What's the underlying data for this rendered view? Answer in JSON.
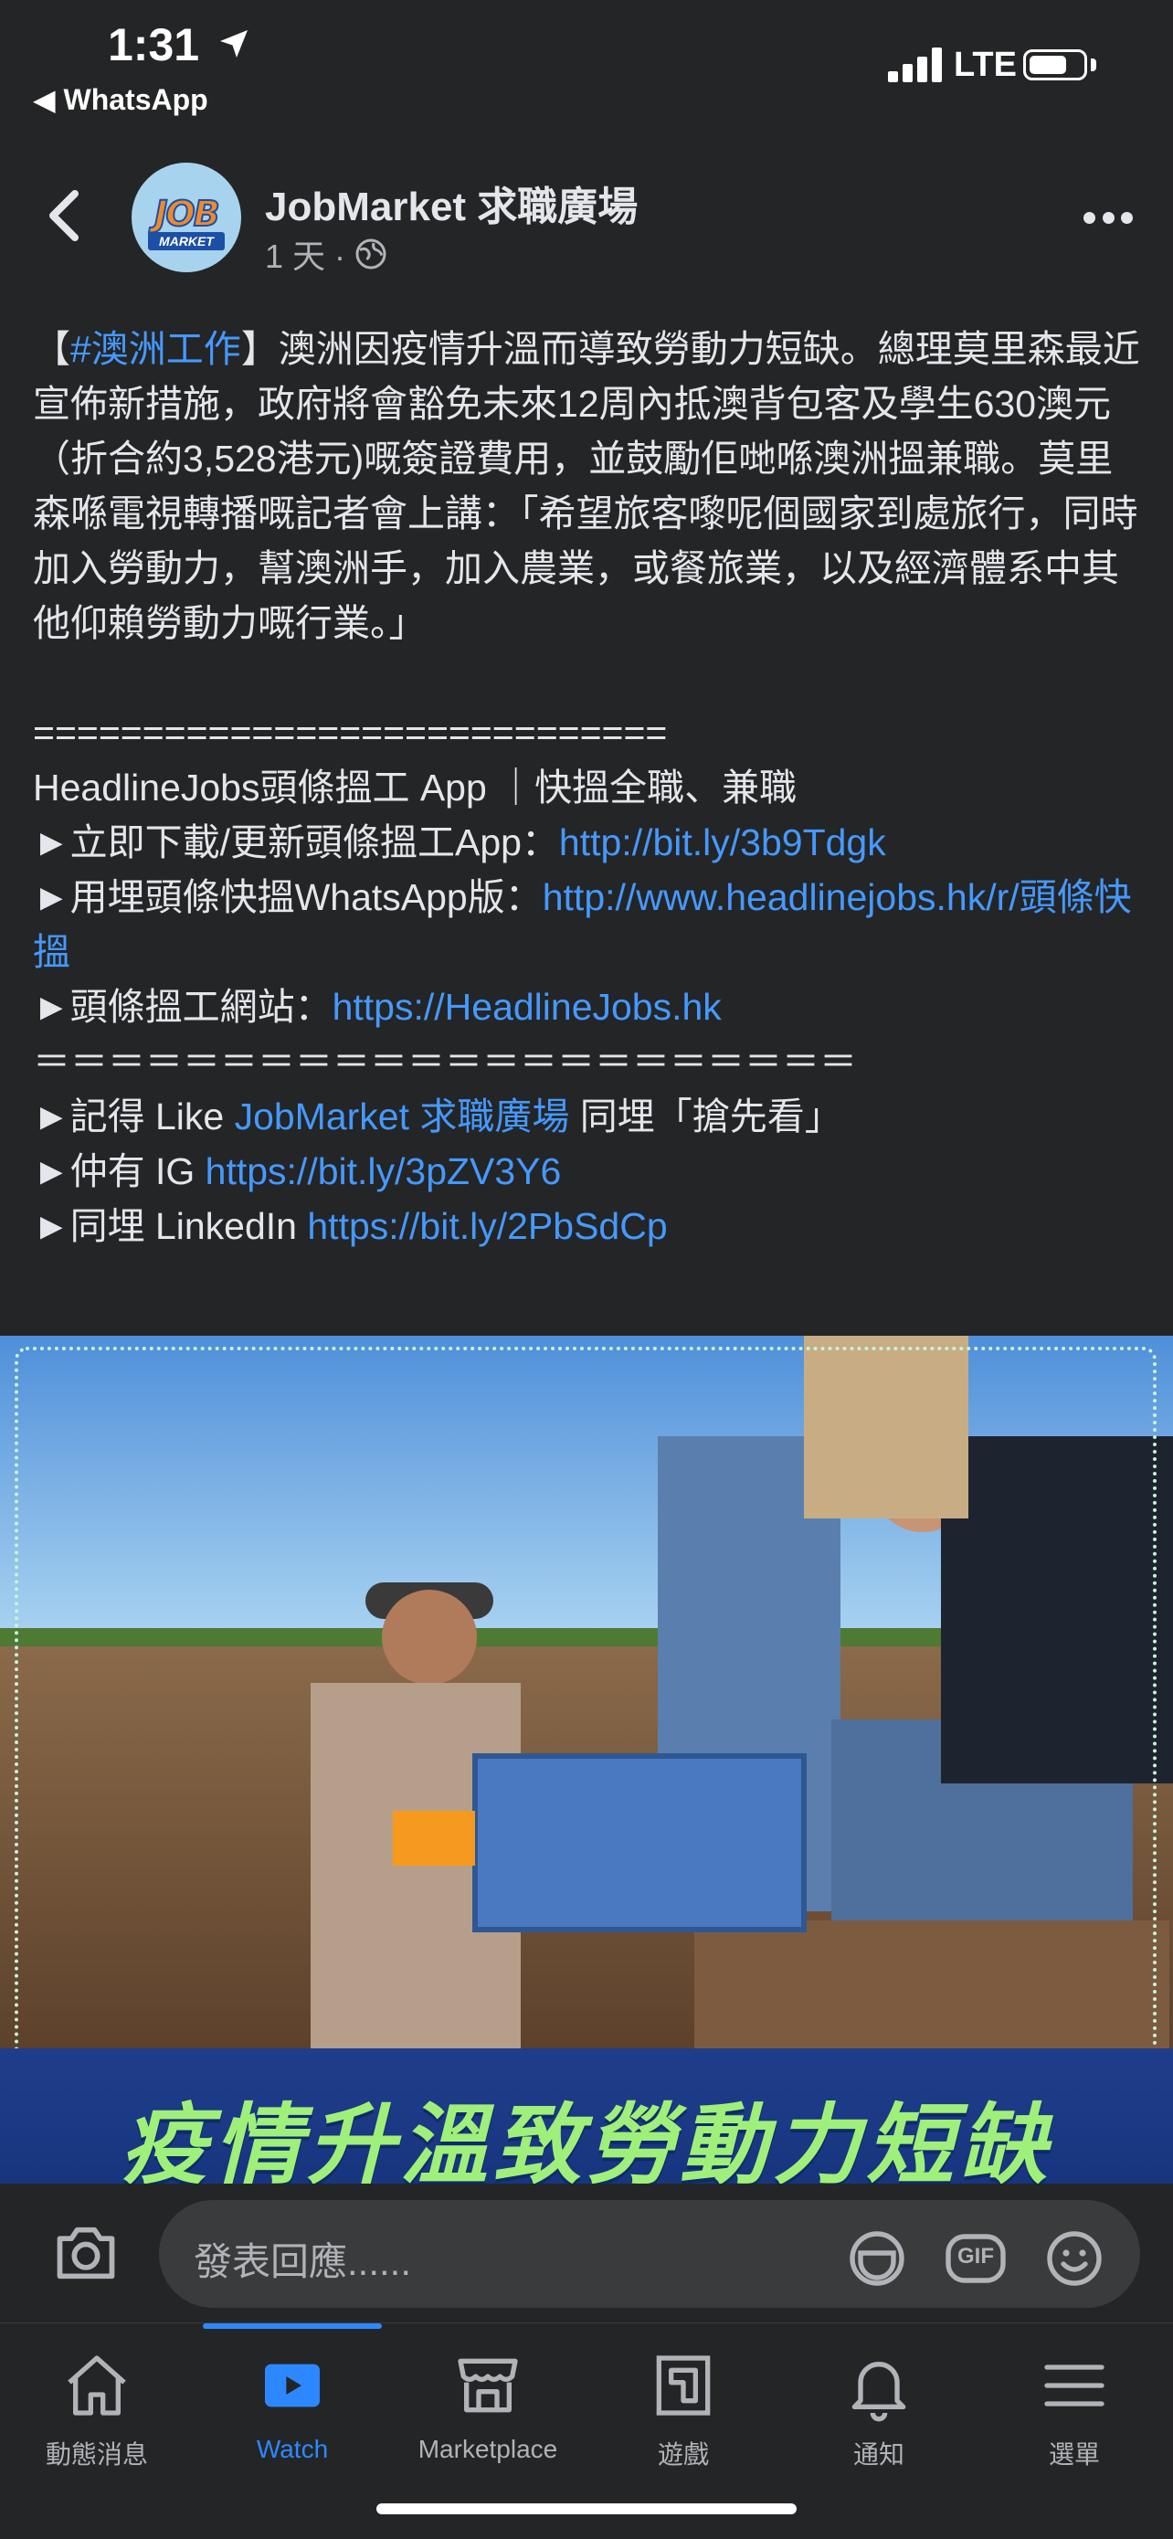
{
  "status_bar": {
    "time": "1:31",
    "back_app": "◀ WhatsApp",
    "network": "LTE"
  },
  "post": {
    "page_name": "JobMarket  求職廣場",
    "time_ago": "1 天 ·",
    "avatar_logo": "JOB",
    "avatar_logo_sub": "MARKET",
    "body": {
      "bracket_open": "【",
      "hashtag": "#澳洲工作",
      "paragraph_rest": "】澳洲因疫情升溫而導致勞動力短缺。總理莫里森最近宣佈新措施，政府將會豁免未來12周內抵澳背包客及學生630澳元（折合約3,528港元)嘅簽證費用，並鼓勵佢哋喺澳洲搵兼職。莫里森喺電視轉播嘅記者會上講：「希望旅客嚟呢個國家到處旅行，同時加入勞動力，幫澳洲手，加入農業，或餐旅業，以及經濟體系中其他仰賴勞動力嘅行業。」",
      "separator1": "=============================",
      "app_title": "HeadlineJobs頭條搵工 App ｜快搵全職、兼職",
      "line1_label": "►立即下載/更新頭條搵工App：",
      "line1_link": "http://bit.ly/3b9Tdgk",
      "line2_label": "►用埋頭條快搵WhatsApp版：",
      "line2_link": "http://www.headlinejobs.hk/r/頭條快搵",
      "line3_label": "►頭條搵工網站：",
      "line3_link": "https://HeadlineJobs.hk",
      "separator2": "＝＝＝＝＝＝＝＝＝＝＝＝＝＝＝＝＝＝＝＝＝＝",
      "line4_label": "►記得 Like ",
      "line4_link": "JobMarket 求職廣場",
      "line4_rest": " 同埋「搶先看」",
      "line5_label": "►仲有 IG ",
      "line5_link": "https://bit.ly/3pZV3Y6",
      "line6_label": "►同埋 LinkedIn ",
      "line6_link": "https://bit.ly/2PbSdCp"
    },
    "image_headline": "疫情升溫致勞動力短缺"
  },
  "comment_bar": {
    "placeholder": "發表回應......",
    "gif_label": "GIF"
  },
  "tabs": [
    {
      "label": "動態消息",
      "icon": "home-icon"
    },
    {
      "label": "Watch",
      "icon": "watch-icon",
      "active": true
    },
    {
      "label": "Marketplace",
      "icon": "marketplace-icon"
    },
    {
      "label": "遊戲",
      "icon": "gaming-icon"
    },
    {
      "label": "通知",
      "icon": "bell-icon"
    },
    {
      "label": "選單",
      "icon": "menu-icon"
    }
  ],
  "colors": {
    "background": "#242526",
    "link": "#4599ff",
    "active_tab": "#2d88ff",
    "headline_green": "#9ff07a",
    "banner_blue": "#1f3d8a"
  }
}
